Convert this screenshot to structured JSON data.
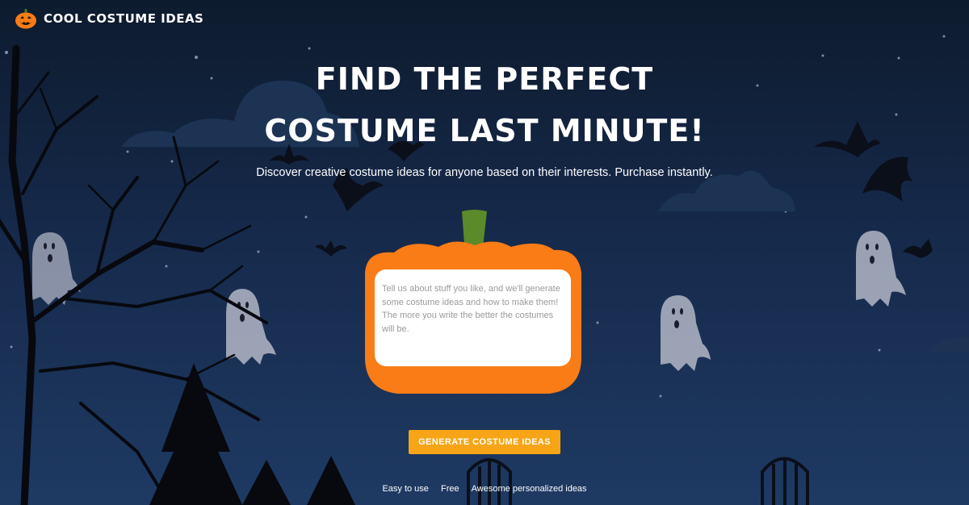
{
  "header": {
    "brand": "Cool Costume Ideas",
    "logo_icon": "pumpkin-icon"
  },
  "hero": {
    "title_line1": "Find the perfect",
    "title_line2": "costume last minute!",
    "subtitle": "Discover creative costume ideas for anyone based on their interests. Purchase instantly."
  },
  "form": {
    "input_value": "",
    "input_placeholder": "Tell us about stuff you like, and we'll generate some costume ideas and how to make them! The more you write the better the costumes will be.",
    "button_label": "GENERATE COSTUME IDEAS"
  },
  "features": [
    "Easy to use",
    "Free",
    "Awesome personalized ideas"
  ],
  "colors": {
    "accent": "#f7a516",
    "pumpkin": "#f97c16",
    "stem": "#5a8a2a",
    "background": "#16294a"
  },
  "decor_icons": [
    "ghost-icon",
    "bat-icon",
    "tree-icon",
    "gate-icon",
    "cloud-icon",
    "star-icon"
  ]
}
